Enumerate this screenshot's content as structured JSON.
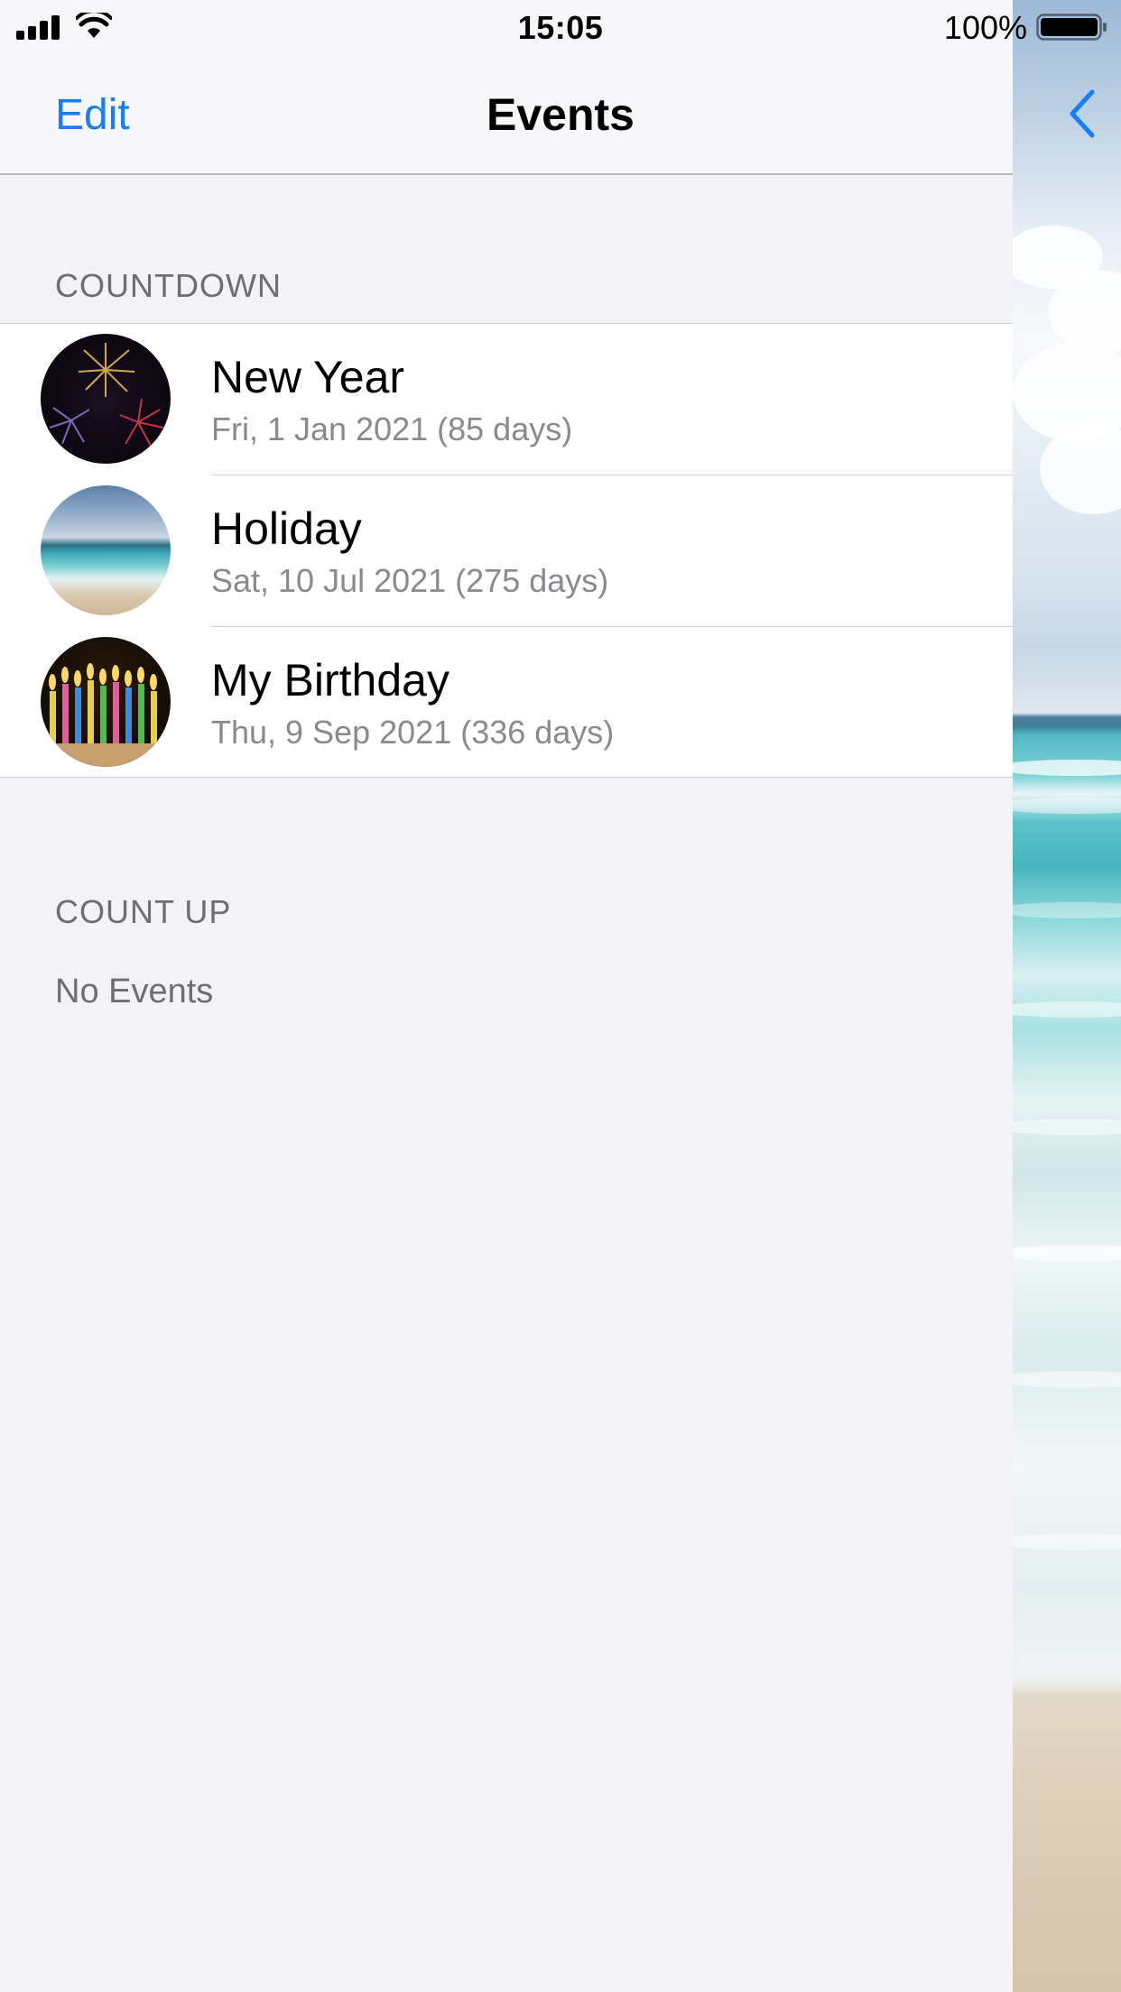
{
  "status_bar": {
    "time": "15:05",
    "battery": "100%"
  },
  "nav": {
    "edit_label": "Edit",
    "title": "Events",
    "back_icon": "chevron-left-icon"
  },
  "countdown": {
    "header": "COUNTDOWN",
    "events": [
      {
        "title": "New Year",
        "subtitle": "Fri, 1 Jan 2021 (85 days)",
        "image": "fireworks"
      },
      {
        "title": "Holiday",
        "subtitle": "Sat, 10 Jul 2021 (275 days)",
        "image": "beach"
      },
      {
        "title": "My Birthday",
        "subtitle": "Thu, 9 Sep 2021 (336 days)",
        "image": "birthday-candles"
      }
    ]
  },
  "countup": {
    "header": "COUNT UP",
    "empty_text": "No Events"
  },
  "colors": {
    "accent": "#147efb",
    "background": "#f2f2f7",
    "secondary_text": "#8a8a8e"
  }
}
